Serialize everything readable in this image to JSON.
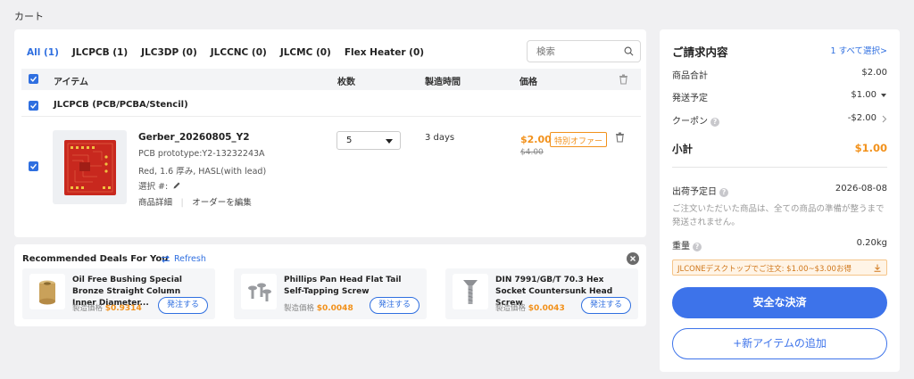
{
  "breadcrumb": "カート",
  "tabs": [
    "All (1)",
    "JLCPCB (1)",
    "JLC3DP (0)",
    "JLCCNC (0)",
    "JLCMC (0)",
    "Flex Heater (0)"
  ],
  "search": {
    "placeholder": "検索"
  },
  "table": {
    "headers": {
      "item": "アイテム",
      "qty": "枚数",
      "time": "製造時間",
      "price": "価格"
    }
  },
  "group": {
    "label": "JLCPCB (PCB/PCBA/Stencil)"
  },
  "item": {
    "name": "Gerber_20260805_Y2",
    "prototype": "PCB prototype:Y2-13232243A",
    "spec": "Red, 1.6 厚み, HASL(with lead)",
    "select_label": "選択 #:",
    "detail_link": "商品詳細",
    "edit_link": "オーダーを編集",
    "qty": "5",
    "days": "3 days",
    "price": "$2.00",
    "old_price": "$4.00",
    "offer_badge": "特別オファー"
  },
  "recommended": {
    "title": "Recommended Deals For You",
    "refresh": "Refresh",
    "items": [
      {
        "name": "Oil Free Bushing Special Bronze Straight Column Inner Diameter...",
        "price_label": "製造価格",
        "price": "$0.9314",
        "button": "発注する"
      },
      {
        "name": "Phillips Pan Head Flat Tail Self-Tapping Screw",
        "price_label": "製造価格",
        "price": "$0.0048",
        "button": "発注する"
      },
      {
        "name": "DIN 7991/GB/T 70.3 Hex Socket Countersunk Head Screw",
        "price_label": "製造価格",
        "price": "$0.0043",
        "button": "発注する"
      }
    ]
  },
  "summary": {
    "title": "ご請求内容",
    "select_link": "1 すべて選択>",
    "subtotal_label": "商品合計",
    "subtotal": "$2.00",
    "shipping_label": "発送予定",
    "shipping": "$1.00",
    "coupon_label": "クーポン",
    "coupon": "-$2.00",
    "total_label": "小計",
    "total": "$1.00",
    "ship_date_label": "出荷予定日",
    "ship_date": "2026-08-08",
    "note": "ご注文いただいた商品は、全ての商品の準備が整うまで発送されません。",
    "weight_label": "重量",
    "weight": "0.20kg",
    "banner": "JLCONEデスクトップでご注文: $1.00~$3.00お得",
    "pay_button": "安全な決済",
    "add_button": "+新アイテムの追加"
  },
  "colors": {
    "accent": "#2f6fe0",
    "price": "#f2911b",
    "pcb": "#c8281e"
  }
}
